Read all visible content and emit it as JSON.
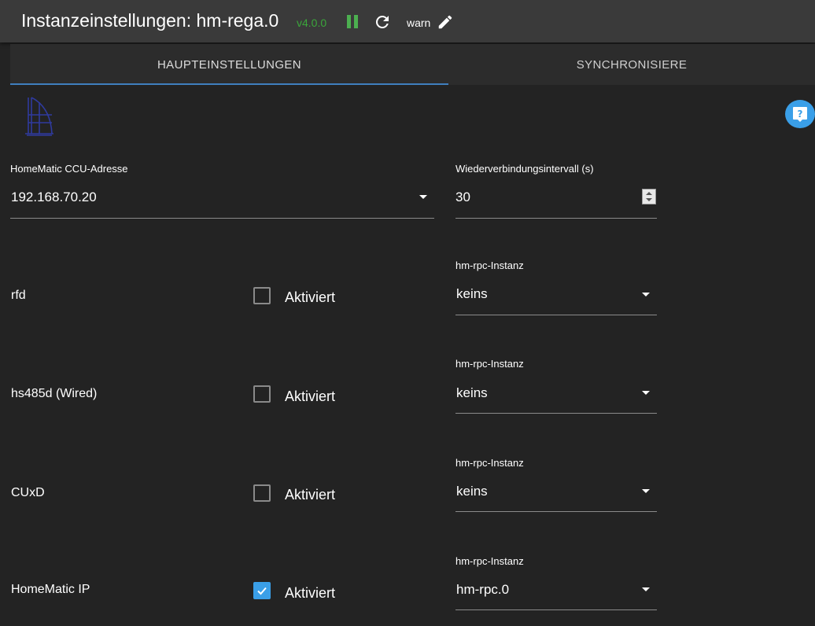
{
  "header": {
    "title": "Instanzeinstellungen: hm-rega.0",
    "version": "v4.0.0",
    "loglevel": "warn"
  },
  "tabs": [
    {
      "label": "HAUPTEINSTELLUNGEN",
      "active": true
    },
    {
      "label": "SYNCHRONISIERE",
      "active": false
    }
  ],
  "settings": {
    "ccu_address": {
      "label": "HomeMatic CCU-Adresse",
      "value": "192.168.70.20"
    },
    "reconnect_interval": {
      "label": "Wiederverbindungsintervall (s)",
      "value": "30"
    }
  },
  "rows": [
    {
      "name": "rfd",
      "checkbox_label": "Aktiviert",
      "checked": false,
      "instance_label": "hm-rpc-Instanz",
      "instance_value": "keins"
    },
    {
      "name": "hs485d (Wired)",
      "checkbox_label": "Aktiviert",
      "checked": false,
      "instance_label": "hm-rpc-Instanz",
      "instance_value": "keins"
    },
    {
      "name": "CUxD",
      "checkbox_label": "Aktiviert",
      "checked": false,
      "instance_label": "hm-rpc-Instanz",
      "instance_value": "keins"
    },
    {
      "name": "HomeMatic IP",
      "checkbox_label": "Aktiviert",
      "checked": true,
      "instance_label": "hm-rpc-Instanz",
      "instance_value": "hm-rpc.0"
    }
  ],
  "colors": {
    "accent": "#3a9fe8",
    "running": "#4caf50",
    "version": "#3aa63a",
    "tab_indicator": "#3f7fbf"
  },
  "icons": {
    "pause": "pause-icon",
    "reload": "reload-icon",
    "edit": "edit-icon",
    "help": "help-icon",
    "logo": "homematic-logo"
  }
}
